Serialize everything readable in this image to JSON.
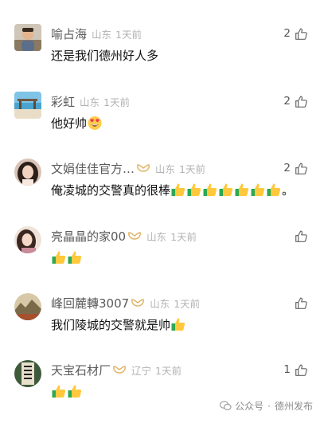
{
  "comments": [
    {
      "nickname": "喻占海",
      "region": "山东",
      "time": "1天前",
      "likes": "2",
      "text": "还是我们德州好人多",
      "avatar_icon": "boy-photo-avatar",
      "has_badge": false
    },
    {
      "nickname": "彩虹",
      "region": "山东",
      "time": "1天前",
      "likes": "2",
      "text": "他好帅",
      "avatar_icon": "beach-photo-avatar",
      "has_badge": false
    },
    {
      "nickname": "文娟佳佳官方…",
      "region": "山东",
      "time": "1天前",
      "likes": "2",
      "text": "俺凌城的交警真的很棒",
      "tail": "。",
      "avatar_icon": "woman-photo-avatar",
      "has_badge": true
    },
    {
      "nickname": "亮晶晶的家00",
      "region": "山东",
      "time": "1天前",
      "likes": "",
      "text": "",
      "avatar_icon": "woman-photo-avatar",
      "has_badge": true
    },
    {
      "nickname": "峰回麓轉3007",
      "region": "山东",
      "time": "1天前",
      "likes": "",
      "text": "我们陵城的交警就是帅",
      "avatar_icon": "landscape-photo-avatar",
      "has_badge": true
    },
    {
      "nickname": "天宝石材厂",
      "region": "辽宁",
      "time": "1天前",
      "likes": "1",
      "text": "",
      "avatar_icon": "calligraphy-photo-avatar",
      "has_badge": true
    }
  ],
  "watermark": {
    "label": "公众号",
    "separator": "·",
    "account": "德州发布"
  },
  "colors": {
    "nickname": "#5a5a5a",
    "meta": "#b2b2b2",
    "text": "#111111",
    "badge": "#e0b56a"
  }
}
